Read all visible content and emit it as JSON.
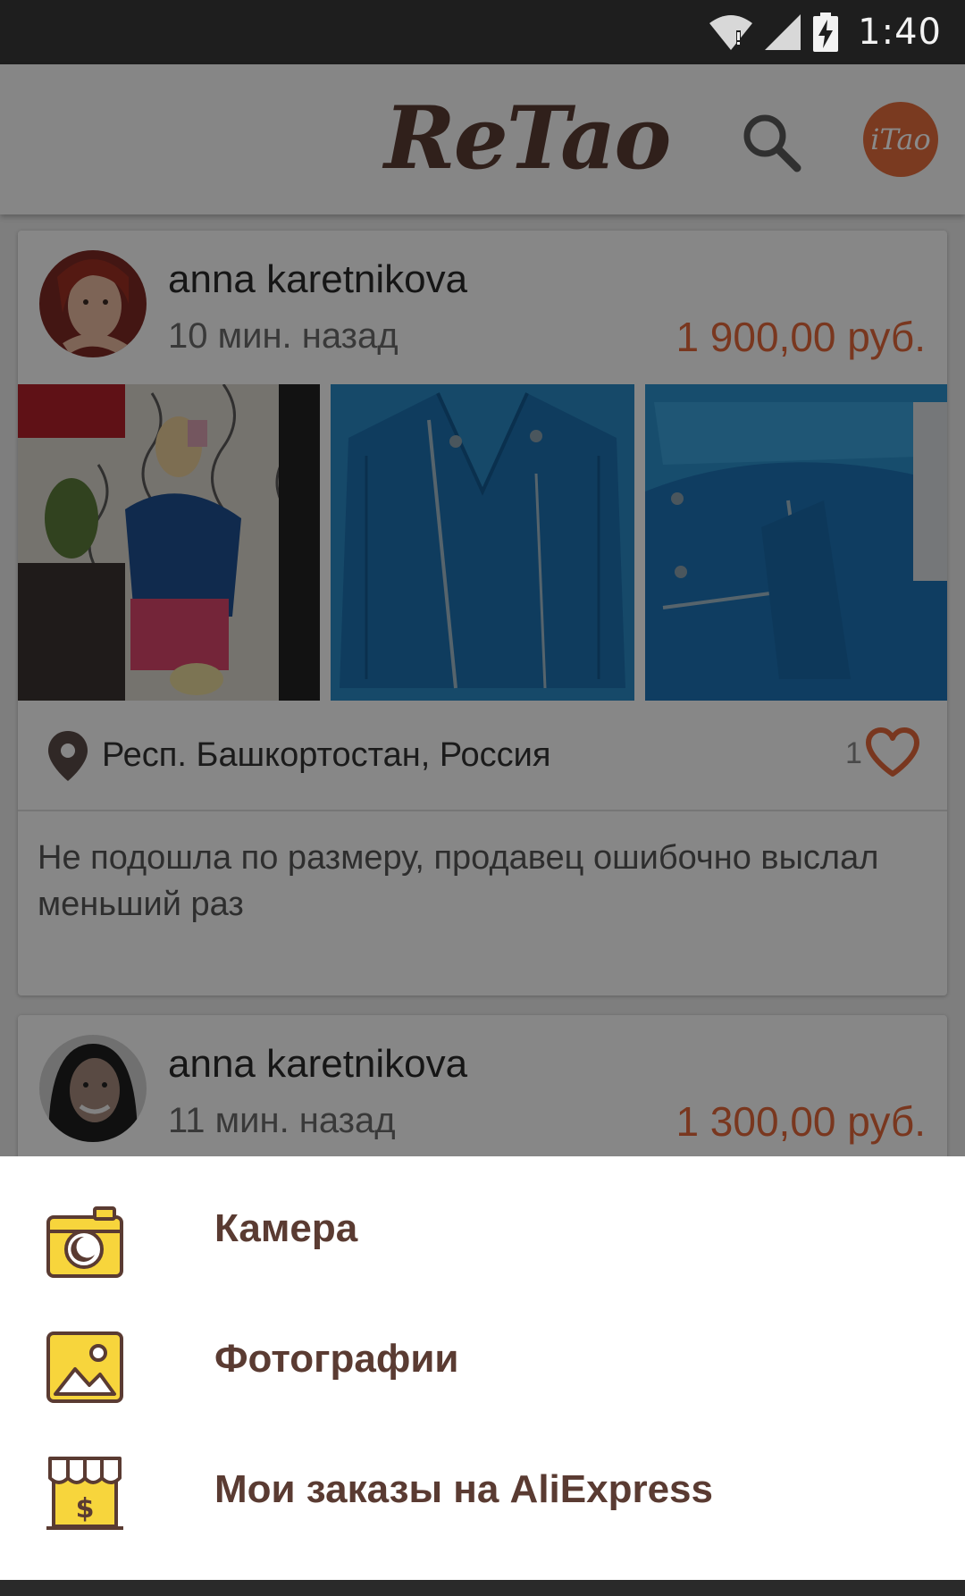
{
  "status_bar": {
    "time": "1:40"
  },
  "app_bar": {
    "logo": "ReTao",
    "itao_label": "iTao"
  },
  "posts": [
    {
      "user": "anna karetnikova",
      "time": "10 мин. назад",
      "price": "1 900,00 руб.",
      "location": "Респ. Башкортостан, Россия",
      "likes": "1",
      "description": "Не подошла по размеру, продавец ошибочно выслал меньший раз"
    },
    {
      "user": "anna karetnikova",
      "time": "11 мин. назад",
      "price": "1 300,00 руб."
    }
  ],
  "sheet": {
    "items": [
      {
        "label": "Камера",
        "icon": "camera-icon"
      },
      {
        "label": "Фотографии",
        "icon": "image-icon"
      },
      {
        "label": "Мои заказы на AliExpress",
        "icon": "store-icon"
      }
    ]
  },
  "colors": {
    "brand_brown": "#5a3b32",
    "accent_orange": "#e0673a",
    "icon_yellow": "#f7d53c"
  }
}
